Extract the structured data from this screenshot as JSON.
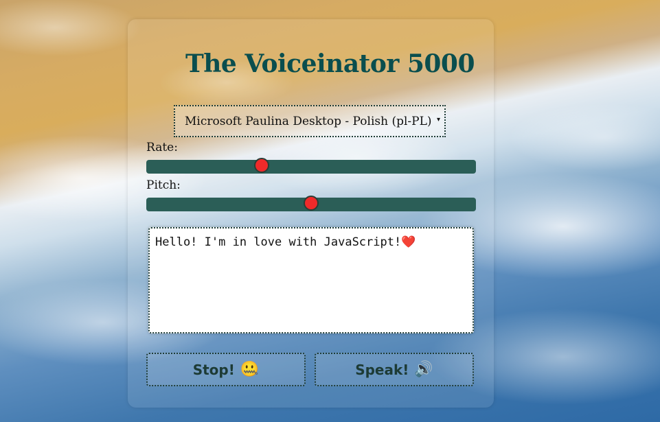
{
  "app": {
    "title": "The Voiceinator 5000"
  },
  "voice_select": {
    "selected": "Microsoft Paulina Desktop - Polish (pl-PL)",
    "arrow": "▾"
  },
  "rate": {
    "label": "Rate:",
    "value_fraction": 0.35
  },
  "pitch": {
    "label": "Pitch:",
    "value_fraction": 0.5
  },
  "message": {
    "text": "Hello! I'm in love with JavaScript!",
    "emoji": "❤️"
  },
  "buttons": {
    "stop_label": "Stop!",
    "stop_emoji": "🤐",
    "speak_label": "Speak!",
    "speak_emoji": "🔊"
  },
  "colors": {
    "title": "#0a4e4e",
    "slider_track": "#2b5e57",
    "slider_thumb": "#f02a2a"
  }
}
